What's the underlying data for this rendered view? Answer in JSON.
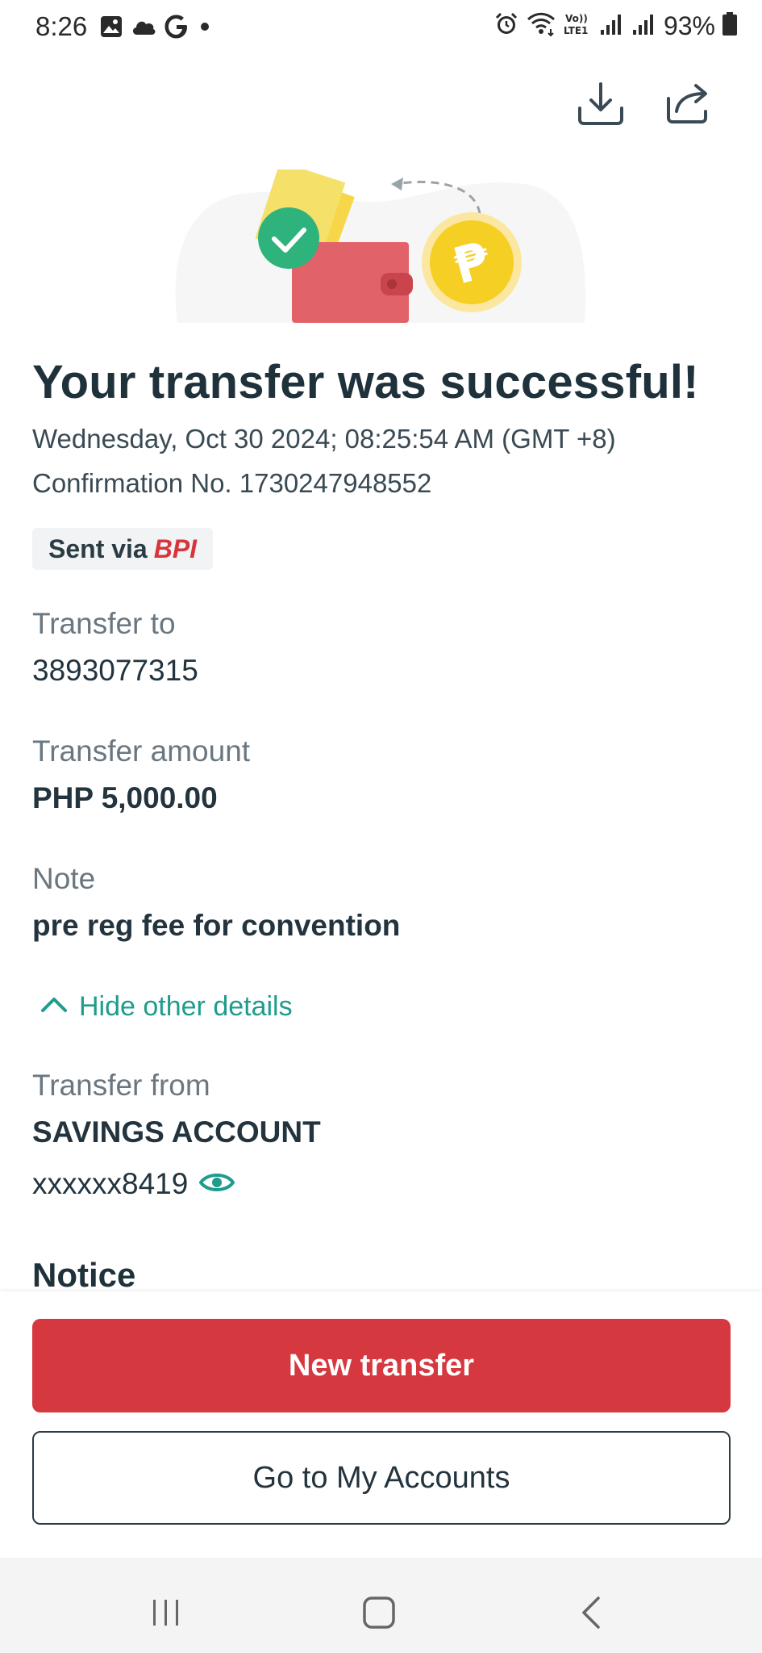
{
  "status_bar": {
    "time": "8:26",
    "battery_percent": "93%",
    "icons": [
      "gallery-icon",
      "cloud-icon",
      "google-icon",
      "dot-icon",
      "alarm-icon",
      "wifi-icon",
      "volte-icon",
      "signal-icon",
      "battery-icon"
    ],
    "volte_label": "Vo)\nLTE1"
  },
  "header": {
    "actions": [
      "download-icon",
      "share-icon"
    ]
  },
  "result": {
    "title": "Your transfer was successful!",
    "datetime": "Wednesday, Oct 30 2024; 08:25:54 AM (GMT +8)",
    "confirmation": "Confirmation No. 1730247948552",
    "sent_via_label": "Sent via",
    "sent_via_bank": "BPI"
  },
  "details": {
    "transfer_to_label": "Transfer to",
    "transfer_to_value": "3893077315",
    "amount_label": "Transfer amount",
    "amount_value": "PHP 5,000.00",
    "note_label": "Note",
    "note_value": "pre reg fee for convention",
    "toggle_label": "Hide other details",
    "from_label": "Transfer from",
    "from_account_type": "SAVINGS ACCOUNT",
    "from_account_number": "xxxxxx8419",
    "notice_heading": "Notice"
  },
  "actions": {
    "primary_label": "New transfer",
    "secondary_label": "Go to My Accounts"
  },
  "colors": {
    "accent_red": "#d5383f",
    "teal": "#1e9c8d",
    "text_dark": "#23343f",
    "coin_yellow": "#f6cf24"
  }
}
